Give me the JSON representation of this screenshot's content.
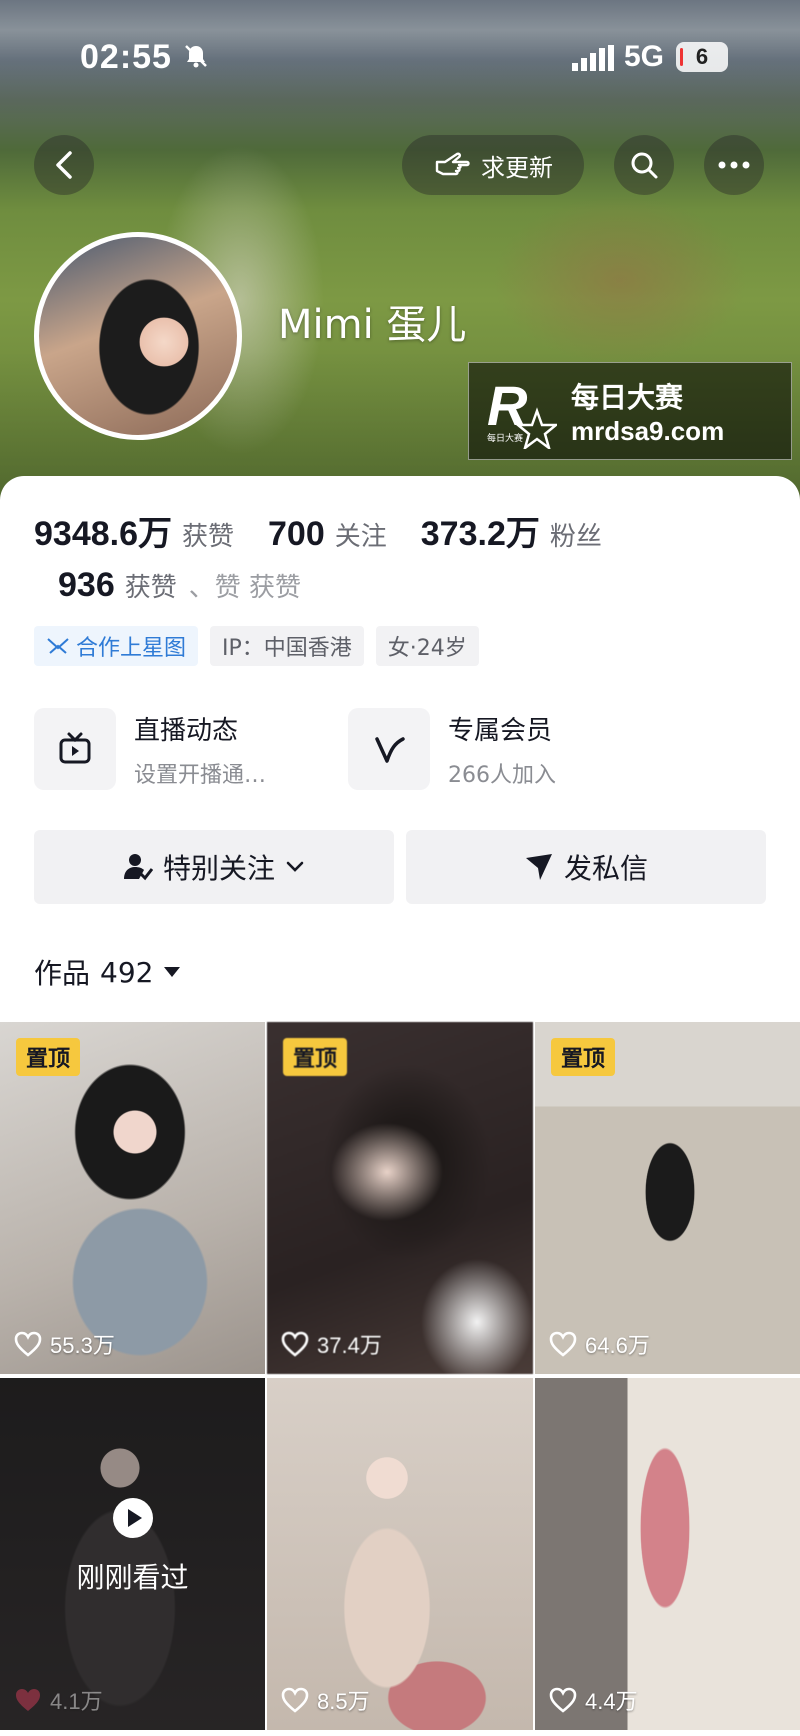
{
  "status_bar": {
    "time": "02:55",
    "network": "5G",
    "battery": "6"
  },
  "header": {
    "update_label": "求更新"
  },
  "profile": {
    "nickname": "Mimi 蛋儿",
    "watermark_cn": "每日大赛",
    "watermark_url": "mrdsa9.com",
    "watermark_logo_letter": "R",
    "watermark_logo_small": "每日大赛"
  },
  "stats": [
    {
      "value": "9348.6万",
      "label": "获赞"
    },
    {
      "value": "700",
      "label": "关注"
    },
    {
      "value": "373.2万",
      "label": "粉丝"
    }
  ],
  "stats2": {
    "value": "936",
    "label": "获赞",
    "faded": "、赞 获赞"
  },
  "tags": [
    {
      "label": "合作上星图",
      "icon": "star-map-icon"
    },
    {
      "label": "IP：中国香港"
    },
    {
      "label": "女·24岁"
    }
  ],
  "features": [
    {
      "title": "直播动态",
      "subtitle": "设置开播通…",
      "icon": "tv-icon"
    },
    {
      "title": "专属会员",
      "subtitle": "266人加入",
      "icon": "v-icon"
    }
  ],
  "actions": {
    "follow_label": "特别关注",
    "message_label": "发私信"
  },
  "works": {
    "label": "作品",
    "count": "492"
  },
  "grid": [
    {
      "pinned": "置顶",
      "likes": "55.3万"
    },
    {
      "pinned": "置顶",
      "likes": "37.4万"
    },
    {
      "pinned": "置顶",
      "likes": "64.6万"
    },
    {
      "viewed": "刚刚看过",
      "likes": "4.1万"
    },
    {
      "likes": "8.5万"
    },
    {
      "likes": "4.4万"
    }
  ],
  "colors": {
    "pin": "#f6c83e",
    "tag_blue": "#2f7bd6",
    "button_bg": "#f1f1f3"
  }
}
